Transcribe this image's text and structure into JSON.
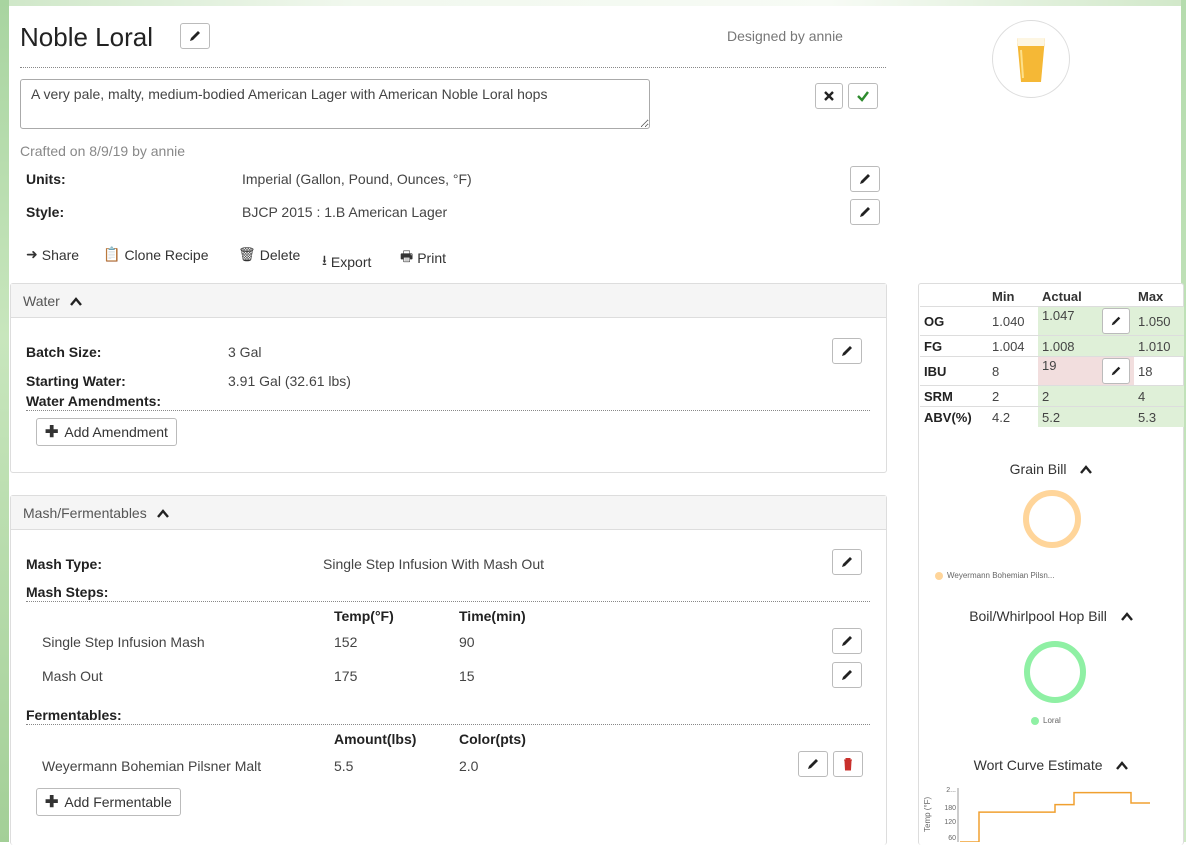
{
  "recipe": {
    "title": "Noble Loral",
    "designed_by": "Designed by annie",
    "description": "A very pale, malty, medium-bodied American Lager with American Noble Loral hops",
    "crafted": "Crafted on 8/9/19 by annie",
    "units_label": "Units:",
    "units_value": "Imperial (Gallon, Pound, Ounces, °F)",
    "style_label": "Style:",
    "style_value": "BJCP 2015 : 1.B American Lager"
  },
  "actions": {
    "share": "Share",
    "clone": "Clone Recipe",
    "delete": "Delete",
    "export": "Export",
    "print": "Print"
  },
  "water": {
    "title": "Water",
    "batch_label": "Batch Size:",
    "batch_value": "3 Gal",
    "starting_label": "Starting Water:",
    "starting_value": "3.91 Gal (32.61 lbs)",
    "amend_label": "Water Amendments:",
    "add_button": "Add Amendment"
  },
  "mash": {
    "title": "Mash/Fermentables",
    "type_label": "Mash Type:",
    "type_value": "Single Step Infusion With Mash Out",
    "steps_label": "Mash Steps:",
    "col_temp": "Temp(°F)",
    "col_time": "Time(min)",
    "steps": [
      {
        "name": "Single Step Infusion Mash",
        "temp": "152",
        "time": "90"
      },
      {
        "name": "Mash Out",
        "temp": "175",
        "time": "15"
      }
    ],
    "ferm_label": "Fermentables:",
    "col_amount": "Amount(lbs)",
    "col_color": "Color(pts)",
    "fermentables": [
      {
        "name": "Weyermann Bohemian Pilsner Malt",
        "amount": "5.5",
        "color": "2.0"
      }
    ],
    "add_button": "Add Fermentable"
  },
  "stats": {
    "headers": [
      "Min",
      "Actual",
      "Max"
    ],
    "rows": [
      {
        "key": "OG",
        "min": "1.040",
        "actual": "1.047",
        "max": "1.050"
      },
      {
        "key": "FG",
        "min": "1.004",
        "actual": "1.008",
        "max": "1.010"
      },
      {
        "key": "IBU",
        "min": "8",
        "actual": "19",
        "max": "18"
      },
      {
        "key": "SRM",
        "min": "2",
        "actual": "2",
        "max": "4"
      },
      {
        "key": "ABV(%)",
        "min": "4.2",
        "actual": "5.2",
        "max": "5.3"
      }
    ]
  },
  "charts": {
    "grain_title": "Grain Bill",
    "grain_legend": "Weyermann Bohemian Pilsn...",
    "hop_title": "Boil/Whirlpool Hop Bill",
    "hop_legend": "Loral",
    "wort_title": "Wort Curve Estimate",
    "wort_ylabel": "Temp (°F)",
    "wort_ticks": [
      "2...",
      "180",
      "120",
      "60"
    ]
  },
  "colors": {
    "grain": "#ffd59a",
    "hop": "#8ff0a4",
    "wort_line": "#f0a030",
    "ok": "#dff0d8",
    "warn": "#f2dede",
    "accent_green": "#2e8b2e",
    "delete_red": "#c9302c"
  },
  "chart_data": {
    "type": "line",
    "title": "Wort Curve Estimate",
    "ylabel": "Temp (°F)",
    "yticks": [
      "2...",
      "180",
      "120",
      "60"
    ],
    "x": [
      0,
      1,
      2,
      3,
      4,
      5,
      6,
      7,
      8,
      9,
      10
    ],
    "values": [
      60,
      152,
      152,
      152,
      152,
      175,
      212,
      212,
      212,
      180,
      180
    ]
  }
}
